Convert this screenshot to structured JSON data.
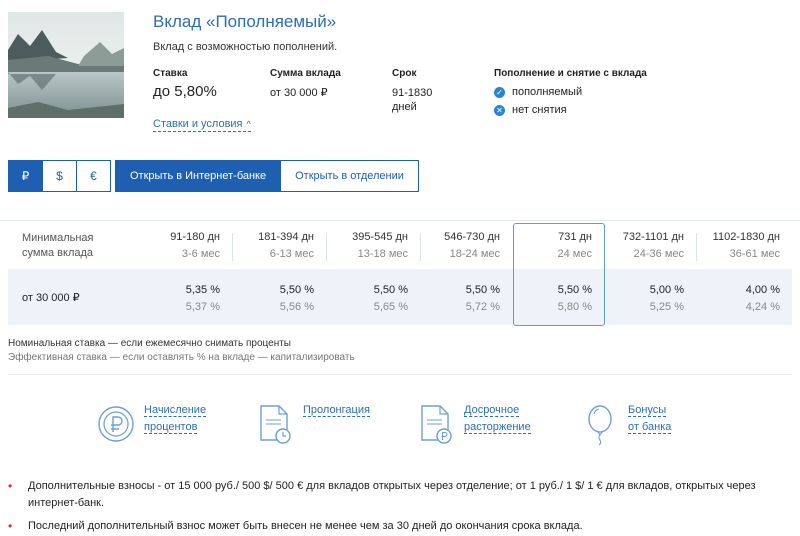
{
  "deposit": {
    "title": "Вклад «Пополняемый»",
    "subtitle": "Вклад с возможностью пополнений."
  },
  "params": {
    "rate_label": "Ставка",
    "rate_value": "до 5,80%",
    "amount_label": "Сумма вклада",
    "amount_value": "от 30 000 ₽",
    "term_label": "Срок",
    "term_value_1": "91-1830",
    "term_value_2": "дней",
    "options_label": "Пополнение и снятие с вклада",
    "option_topup": "пополняемый",
    "option_withdraw": "нет снятия"
  },
  "rates_link": "Ставки и условия",
  "currencies": [
    "₽",
    "$",
    "€"
  ],
  "open_buttons": {
    "online": "Открыть в Интернет-банке",
    "office": "Открыть в отделении"
  },
  "table": {
    "min_head_1": "Минимальная",
    "min_head_2": "сумма вклада",
    "row_label": "от 30 000 ₽",
    "columns": [
      {
        "days": "91-180 дн",
        "months": "3-6 мес",
        "nominal": "5,35  %",
        "effective": "5,37  %"
      },
      {
        "days": "181-394 дн",
        "months": "6-13 мес",
        "nominal": "5,50  %",
        "effective": "5,56  %"
      },
      {
        "days": "395-545 дн",
        "months": "13-18 мес",
        "nominal": "5,50  %",
        "effective": "5,65  %"
      },
      {
        "days": "546-730 дн",
        "months": "18-24 мес",
        "nominal": "5,50  %",
        "effective": "5,72  %"
      },
      {
        "days": "731 дн",
        "months": "24 мес",
        "nominal": "5,50  %",
        "effective": "5,80  %"
      },
      {
        "days": "732-1101 дн",
        "months": "24-36 мес",
        "nominal": "5,00  %",
        "effective": "5,25  %"
      },
      {
        "days": "1102-1830 дн",
        "months": "36-61 мес",
        "nominal": "4,00  %",
        "effective": "4,24  %"
      }
    ]
  },
  "notes": {
    "nominal": "Номинальная ставка — если ежемесячно снимать проценты",
    "effective": "Эффективная ставка — если оставлять % на вкладе — капитализировать"
  },
  "features": [
    {
      "line1": "Начисление",
      "line2": "процентов",
      "icon": "ruble-coin-icon"
    },
    {
      "line1": "Пролонгация",
      "line2": "",
      "icon": "document-clock-icon"
    },
    {
      "line1": "Досрочное",
      "line2": "расторжение",
      "icon": "document-ruble-icon"
    },
    {
      "line1": "Бонусы",
      "line2": "от банка",
      "icon": "balloon-icon"
    }
  ],
  "bullets": [
    "Дополнительные взносы - от 15 000  руб./ 500 $/ 500 € для вкладов открытых через отделение; от 1  руб./ 1 $/ 1 € для вкладов, открытых через интернет-банк.",
    "Последний дополнительный взнос может быть внесен не менее чем за 30 дней до окончания срока вклада."
  ],
  "colors": {
    "brand": "#1f5fb2",
    "link": "#2c6db5",
    "row_bg": "#eef2f9",
    "bullet": "#d4312f"
  }
}
